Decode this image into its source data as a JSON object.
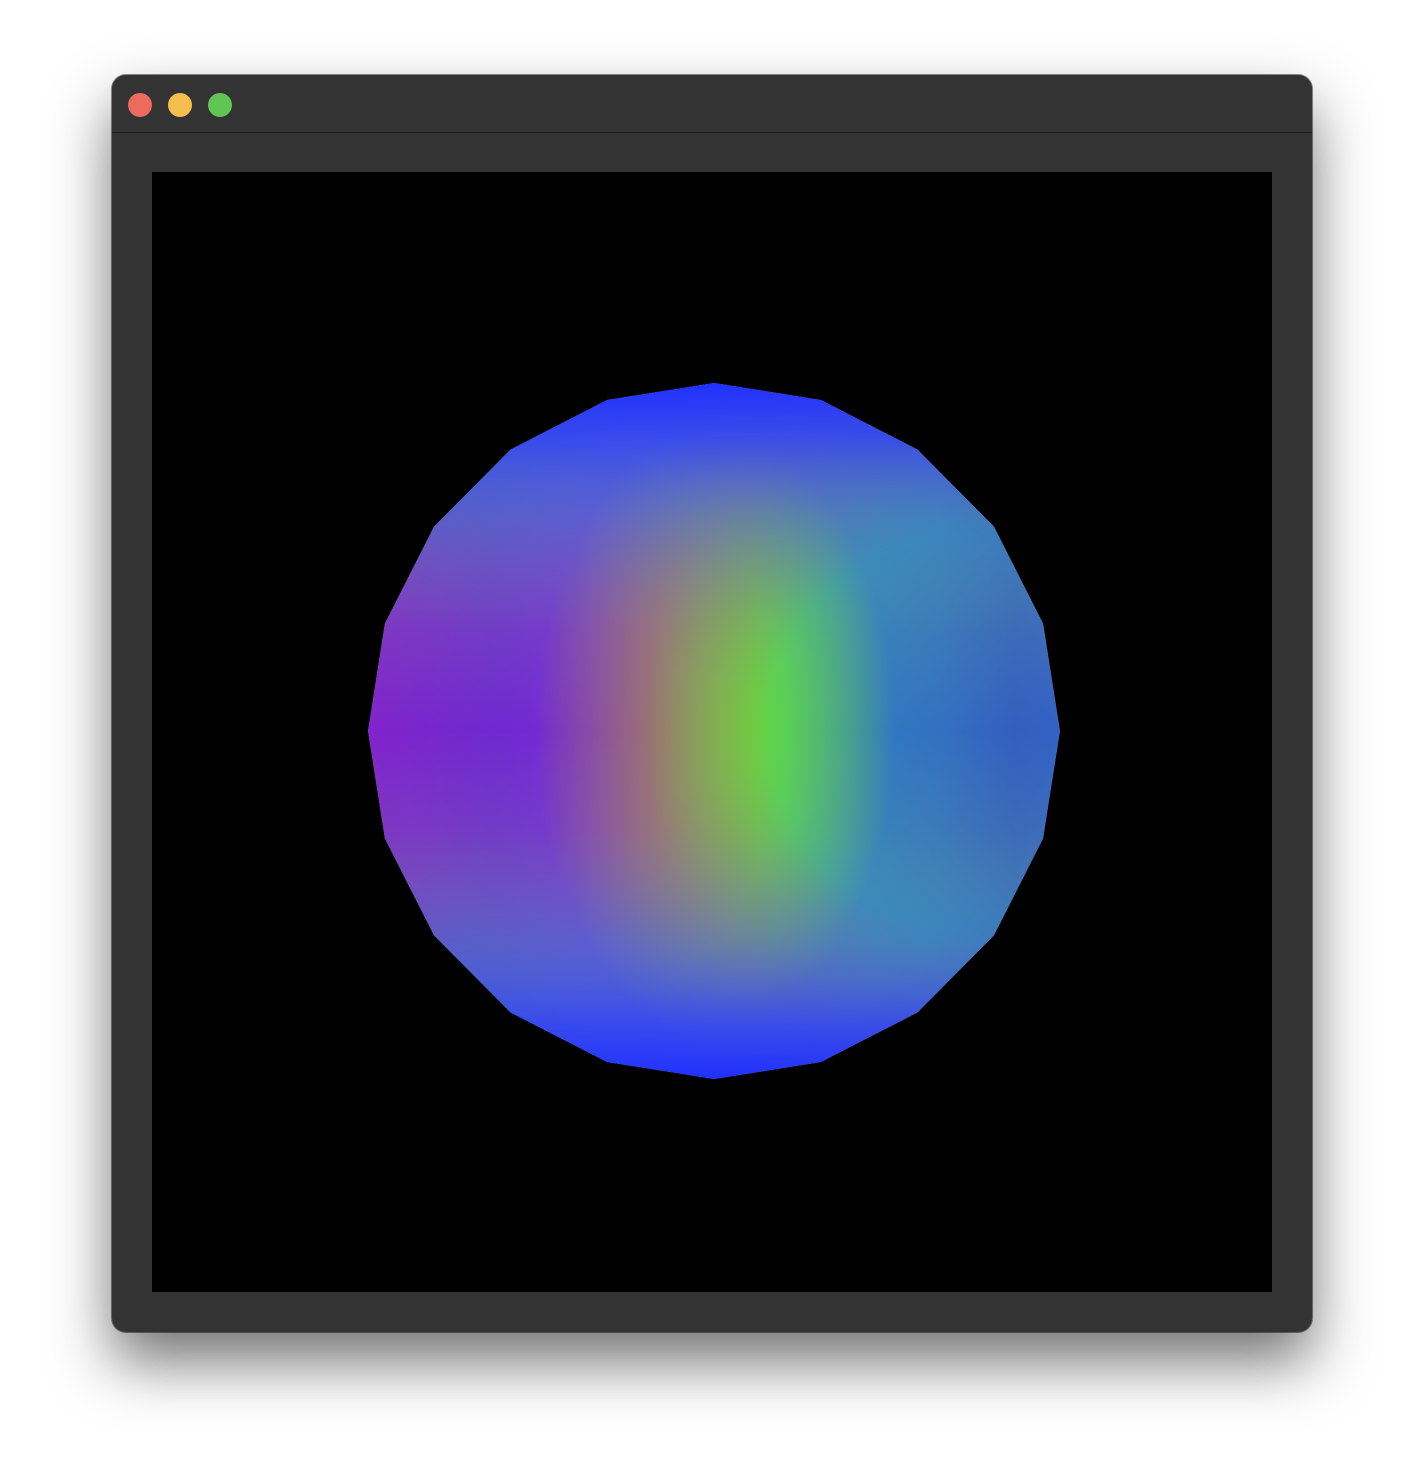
{
  "window": {
    "controls": {
      "close_color": "#ED6A5E",
      "minimize_color": "#F5BF4F",
      "maximize_color": "#61C554"
    },
    "canvas": {
      "background": "#000000",
      "object": "sphere-icon",
      "shading": "hue-by-longitude",
      "colors": {
        "front_center": "#8CD600",
        "left_rim": "#00FF00",
        "right_rim": "#FF0000",
        "top": "#2040FF",
        "bottom": "#2040FF"
      }
    }
  }
}
